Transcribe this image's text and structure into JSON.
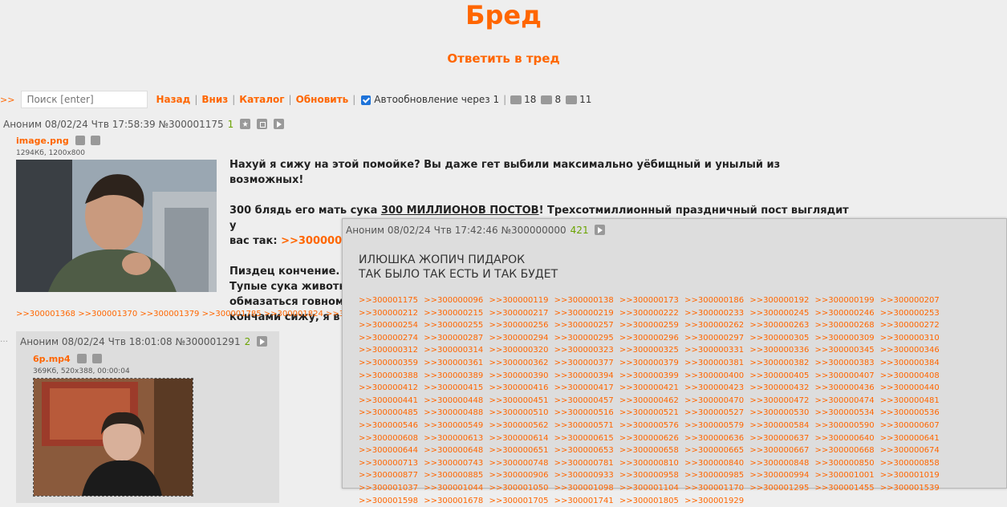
{
  "board": {
    "title": "Бред",
    "reply_link": "Ответить в тред"
  },
  "nav": {
    "prefix": ">>",
    "search_placeholder": "Поиск [enter]",
    "back": "Назад",
    "down": "Вниз",
    "catalog": "Каталог",
    "refresh": "Обновить",
    "autoupdate": "Автообновление через 1",
    "stats": {
      "posts": "18",
      "images": "8",
      "posters": "11"
    }
  },
  "op": {
    "author": "Аноним",
    "datetime": "08/02/24 Чтв 17:58:39",
    "number": "№300001175",
    "counter": "1",
    "file": {
      "name": "image.png",
      "info": "1294Кб, 1200x800"
    },
    "text": {
      "line1": "Нахуй я сижу на этой помойке? Вы даже гет выбили максимально уёбищный и унылый из возможных!",
      "line2_a": "300 блядь его мать сука ",
      "line2_u": "300 МИЛЛИОНОВ ПОСТОВ",
      "line2_b": "! Трехсотмиллионный праздничный пост выглядит у",
      "line3_a": "вас так: ",
      "line3_link": ">>300000000 →",
      "line4": "Пиздец кончение.",
      "line5": "Тупые сука животн",
      "line6": "обмазаться говном",
      "line7": "кончами сижу, я в"
    },
    "replies": ">>300001368 >>300001370 >>300001379 >>300001785 >>300001824 >>300001"
  },
  "reply": {
    "author": "Аноним",
    "datetime": "08/02/24 Чтв 18:01:08",
    "number": "№300001291",
    "counter": "2",
    "file": {
      "name": "6p.mp4",
      "info": "369Кб, 520x388, 00:00:04"
    }
  },
  "popup": {
    "author": "Аноним",
    "datetime": "08/02/24 Чтв 17:42:46",
    "number": "№300000000",
    "counter": "421",
    "line1": "ИЛЮШКА ЖОПИЧ ПИДАРОК",
    "line2": "ТАК БЫЛО ТАК ЕСТЬ И ТАК БУДЕТ",
    "refs": [
      ">>300001175",
      ">>300000096",
      ">>300000119",
      ">>300000138",
      ">>300000173",
      ">>300000186",
      ">>300000192",
      ">>300000199",
      ">>300000207",
      ">>300000212",
      ">>300000215",
      ">>300000217",
      ">>300000219",
      ">>300000222",
      ">>300000233",
      ">>300000245",
      ">>300000246",
      ">>300000253",
      ">>300000254",
      ">>300000255",
      ">>300000256",
      ">>300000257",
      ">>300000259",
      ">>300000262",
      ">>300000263",
      ">>300000268",
      ">>300000272",
      ">>300000274",
      ">>300000287",
      ">>300000294",
      ">>300000295",
      ">>300000296",
      ">>300000297",
      ">>300000305",
      ">>300000309",
      ">>300000310",
      ">>300000312",
      ">>300000314",
      ">>300000320",
      ">>300000323",
      ">>300000325",
      ">>300000331",
      ">>300000336",
      ">>300000345",
      ">>300000346",
      ">>300000359",
      ">>300000361",
      ">>300000362",
      ">>300000377",
      ">>300000379",
      ">>300000381",
      ">>300000382",
      ">>300000383",
      ">>300000384",
      ">>300000388",
      ">>300000389",
      ">>300000390",
      ">>300000394",
      ">>300000399",
      ">>300000400",
      ">>300000405",
      ">>300000407",
      ">>300000408",
      ">>300000412",
      ">>300000415",
      ">>300000416",
      ">>300000417",
      ">>300000421",
      ">>300000423",
      ">>300000432",
      ">>300000436",
      ">>300000440",
      ">>300000441",
      ">>300000448",
      ">>300000451",
      ">>300000457",
      ">>300000462",
      ">>300000470",
      ">>300000472",
      ">>300000474",
      ">>300000481",
      ">>300000485",
      ">>300000488",
      ">>300000510",
      ">>300000516",
      ">>300000521",
      ">>300000527",
      ">>300000530",
      ">>300000534",
      ">>300000536",
      ">>300000546",
      ">>300000549",
      ">>300000562",
      ">>300000571",
      ">>300000576",
      ">>300000579",
      ">>300000584",
      ">>300000590",
      ">>300000607",
      ">>300000608",
      ">>300000613",
      ">>300000614",
      ">>300000615",
      ">>300000626",
      ">>300000636",
      ">>300000637",
      ">>300000640",
      ">>300000641",
      ">>300000644",
      ">>300000648",
      ">>300000651",
      ">>300000653",
      ">>300000658",
      ">>300000665",
      ">>300000667",
      ">>300000668",
      ">>300000674",
      ">>300000713",
      ">>300000743",
      ">>300000748",
      ">>300000781",
      ">>300000810",
      ">>300000840",
      ">>300000848",
      ">>300000850",
      ">>300000858",
      ">>300000877",
      ">>300000885",
      ">>300000906",
      ">>300000933",
      ">>300000958",
      ">>300000985",
      ">>300000994",
      ">>300001001",
      ">>300001019",
      ">>300001037",
      ">>300001044",
      ">>300001050",
      ">>300001098",
      ">>300001104",
      ">>300001170",
      ">>300001295",
      ">>300001455",
      ">>300001539",
      ">>300001598",
      ">>300001678",
      ">>300001705",
      ">>300001741",
      ">>300001805",
      ">>300001929"
    ]
  }
}
